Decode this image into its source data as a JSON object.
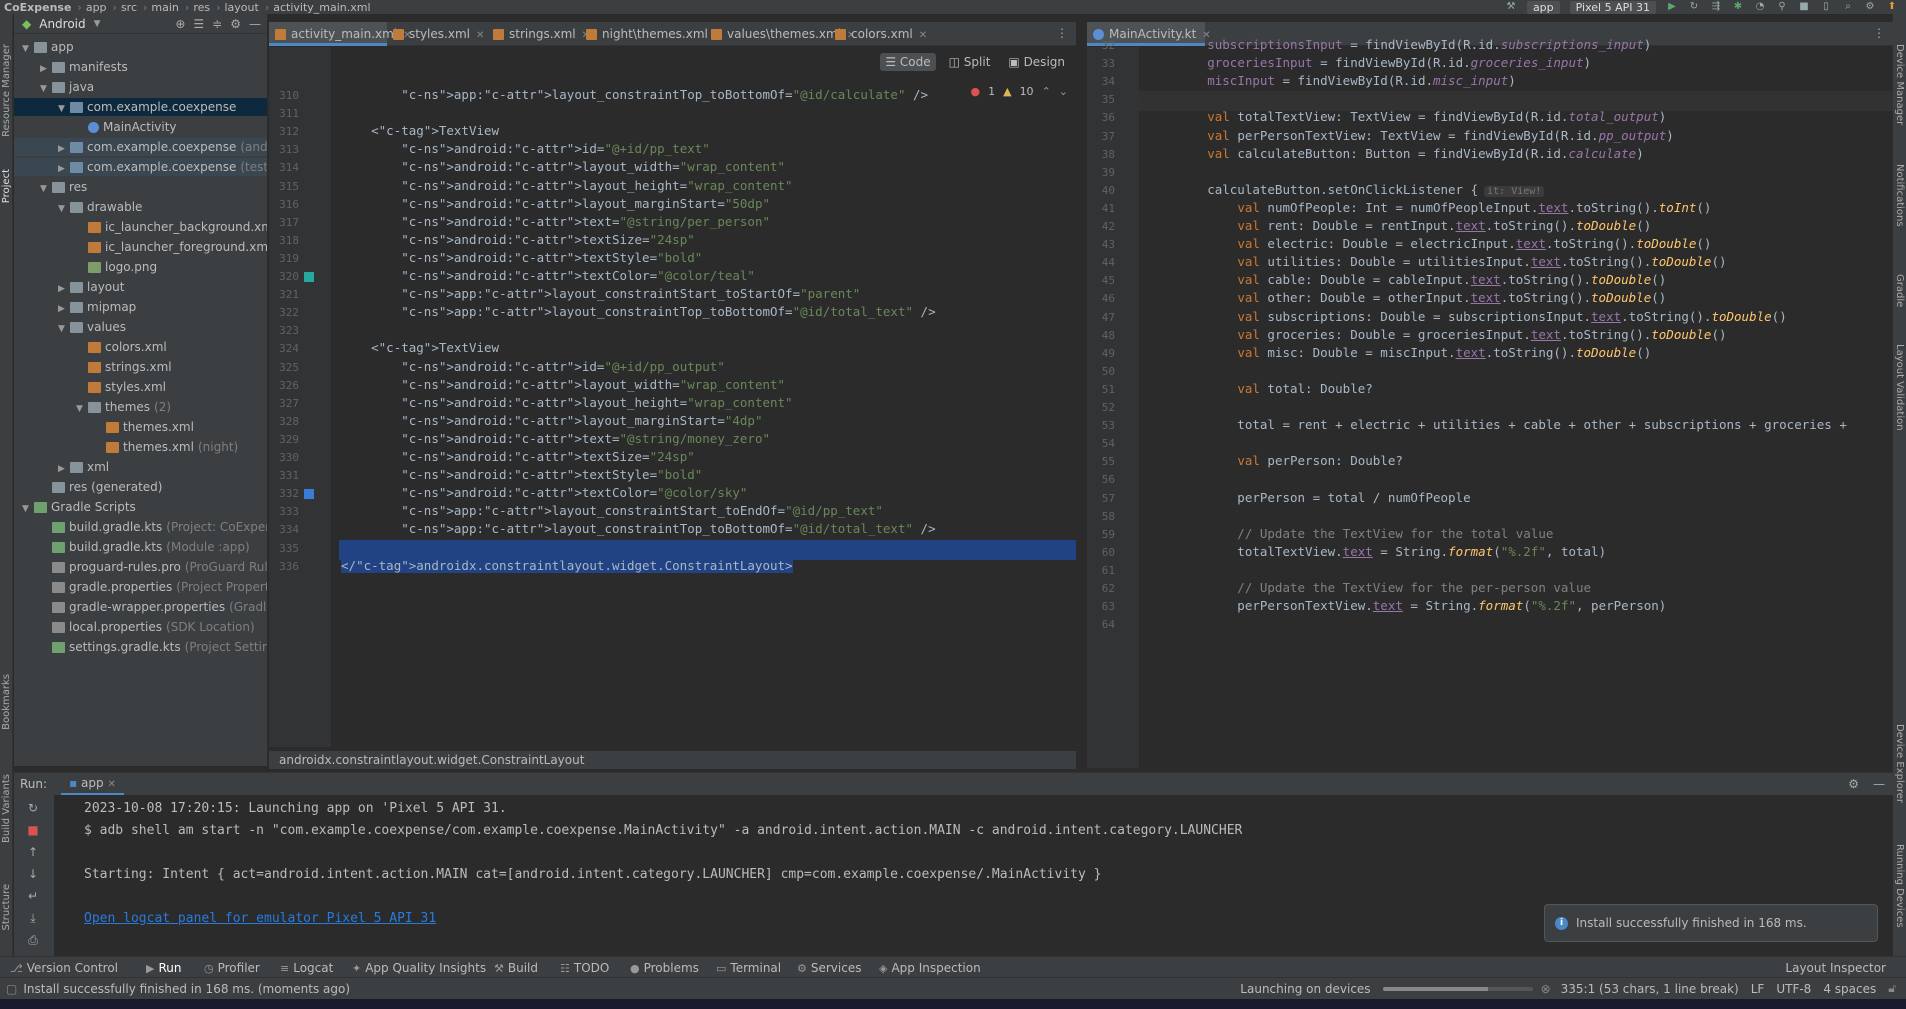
{
  "breadcrumb": [
    "CoExpense",
    "app",
    "src",
    "main",
    "res",
    "layout",
    "activity_main.xml"
  ],
  "toolbar": {
    "run_config": "app",
    "device": "Pixel 5 API 31"
  },
  "project_panel": {
    "view": "Android",
    "items": [
      {
        "label": "app",
        "sub": "",
        "icon": "folder"
      },
      {
        "label": "manifests",
        "sub": "",
        "icon": "folder"
      },
      {
        "label": "java",
        "sub": "",
        "icon": "folder"
      },
      {
        "label": "com.example.coexpense",
        "sub": "",
        "icon": "package"
      },
      {
        "label": "MainActivity",
        "sub": "",
        "icon": "kotlin-file"
      },
      {
        "label": "com.example.coexpense",
        "sub": "(androidTest)",
        "icon": "package"
      },
      {
        "label": "com.example.coexpense",
        "sub": "(test)",
        "icon": "package"
      },
      {
        "label": "res",
        "sub": "",
        "icon": "folder"
      },
      {
        "label": "drawable",
        "sub": "",
        "icon": "folder"
      },
      {
        "label": "ic_launcher_background.xml",
        "sub": "",
        "icon": "xml-file"
      },
      {
        "label": "ic_launcher_foreground.xml",
        "sub": "",
        "icon": "xml-file"
      },
      {
        "label": "logo.png",
        "sub": "",
        "icon": "image-file"
      },
      {
        "label": "layout",
        "sub": "",
        "icon": "folder"
      },
      {
        "label": "mipmap",
        "sub": "",
        "icon": "folder"
      },
      {
        "label": "values",
        "sub": "",
        "icon": "folder"
      },
      {
        "label": "colors.xml",
        "sub": "",
        "icon": "xml-file"
      },
      {
        "label": "strings.xml",
        "sub": "",
        "icon": "xml-file"
      },
      {
        "label": "styles.xml",
        "sub": "",
        "icon": "xml-file"
      },
      {
        "label": "themes",
        "sub": "(2)",
        "icon": "folder"
      },
      {
        "label": "themes.xml",
        "sub": "",
        "icon": "xml-file"
      },
      {
        "label": "themes.xml",
        "sub": "(night)",
        "icon": "xml-file"
      },
      {
        "label": "xml",
        "sub": "",
        "icon": "folder"
      },
      {
        "label": "res (generated)",
        "sub": "",
        "icon": "folder"
      },
      {
        "label": "Gradle Scripts",
        "sub": "",
        "icon": "gradle"
      },
      {
        "label": "build.gradle.kts",
        "sub": "(Project: CoExpense)",
        "icon": "gradle-file"
      },
      {
        "label": "build.gradle.kts",
        "sub": "(Module :app)",
        "icon": "gradle-file"
      },
      {
        "label": "proguard-rules.pro",
        "sub": "(ProGuard Rules for \":app\")",
        "icon": "properties-file"
      },
      {
        "label": "gradle.properties",
        "sub": "(Project Properties)",
        "icon": "properties-file"
      },
      {
        "label": "gradle-wrapper.properties",
        "sub": "(Gradle Version)",
        "icon": "properties-file"
      },
      {
        "label": "local.properties",
        "sub": "(SDK Location)",
        "icon": "properties-file"
      },
      {
        "label": "settings.gradle.kts",
        "sub": "(Project Settings)",
        "icon": "gradle-file"
      }
    ]
  },
  "editor_tabs_left": [
    "activity_main.xml",
    "styles.xml",
    "strings.xml",
    "night\\themes.xml",
    "values\\themes.xml",
    "colors.xml"
  ],
  "editor_tabs_right": [
    "MainActivity.kt"
  ],
  "view_modes": [
    "Code",
    "Split",
    "Design"
  ],
  "inspections": {
    "errors": "1",
    "warnings": "10"
  },
  "xml_editor": {
    "lines": [
      {
        "n": "310",
        "text": "        app:layout_constraintTop_toBottomOf=\"@id/calculate\" />"
      },
      {
        "n": "311",
        "text": ""
      },
      {
        "n": "312",
        "text": "    <TextView"
      },
      {
        "n": "313",
        "text": "        android:id=\"@+id/pp_text\""
      },
      {
        "n": "314",
        "text": "        android:layout_width=\"wrap_content\""
      },
      {
        "n": "315",
        "text": "        android:layout_height=\"wrap_content\""
      },
      {
        "n": "316",
        "text": "        android:layout_marginStart=\"50dp\""
      },
      {
        "n": "317",
        "text": "        android:text=\"@string/per_person\""
      },
      {
        "n": "318",
        "text": "        android:textSize=\"24sp\""
      },
      {
        "n": "319",
        "text": "        android:textStyle=\"bold\""
      },
      {
        "n": "320",
        "text": "        android:textColor=\"@color/teal\""
      },
      {
        "n": "321",
        "text": "        app:layout_constraintStart_toStartOf=\"parent\""
      },
      {
        "n": "322",
        "text": "        app:layout_constraintTop_toBottomOf=\"@id/total_text\" />"
      },
      {
        "n": "323",
        "text": ""
      },
      {
        "n": "324",
        "text": "    <TextView"
      },
      {
        "n": "325",
        "text": "        android:id=\"@+id/pp_output\""
      },
      {
        "n": "326",
        "text": "        android:layout_width=\"wrap_content\""
      },
      {
        "n": "327",
        "text": "        android:layout_height=\"wrap_content\""
      },
      {
        "n": "328",
        "text": "        android:layout_marginStart=\"4dp\""
      },
      {
        "n": "329",
        "text": "        android:text=\"@string/money_zero\""
      },
      {
        "n": "330",
        "text": "        android:textSize=\"24sp\""
      },
      {
        "n": "331",
        "text": "        android:textStyle=\"bold\""
      },
      {
        "n": "332",
        "text": "        android:textColor=\"@color/sky\""
      },
      {
        "n": "333",
        "text": "        app:layout_constraintStart_toEndOf=\"@id/pp_text\""
      },
      {
        "n": "334",
        "text": "        app:layout_constraintTop_toBottomOf=\"@id/total_text\" />"
      },
      {
        "n": "335",
        "text": ""
      },
      {
        "n": "336",
        "text": "</androidx.constraintlayout.widget.ConstraintLayout>"
      }
    ],
    "footer_path": "androidx.constraintlayout.widget.ConstraintLayout"
  },
  "kt_editor": {
    "lines": [
      {
        "n": "32",
        "text": "        subscriptionsInput = findViewById(R.id.subscriptions_input)"
      },
      {
        "n": "33",
        "text": "        groceriesInput = findViewById(R.id.groceries_input)"
      },
      {
        "n": "34",
        "text": "        miscInput = findViewById(R.id.misc_input)"
      },
      {
        "n": "35",
        "text": ""
      },
      {
        "n": "36",
        "text": "        val totalTextView: TextView = findViewById(R.id.total_output)"
      },
      {
        "n": "37",
        "text": "        val perPersonTextView: TextView = findViewById(R.id.pp_output)"
      },
      {
        "n": "38",
        "text": "        val calculateButton: Button = findViewById(R.id.calculate)"
      },
      {
        "n": "39",
        "text": ""
      },
      {
        "n": "40",
        "text": "        calculateButton.setOnClickListener {"
      },
      {
        "n": "41",
        "text": "            val numOfPeople: Int = numOfPeopleInput.text.toString().toInt()"
      },
      {
        "n": "42",
        "text": "            val rent: Double = rentInput.text.toString().toDouble()"
      },
      {
        "n": "43",
        "text": "            val electric: Double = electricInput.text.toString().toDouble()"
      },
      {
        "n": "44",
        "text": "            val utilities: Double = utilitiesInput.text.toString().toDouble()"
      },
      {
        "n": "45",
        "text": "            val cable: Double = cableInput.text.toString().toDouble()"
      },
      {
        "n": "46",
        "text": "            val other: Double = otherInput.text.toString().toDouble()"
      },
      {
        "n": "47",
        "text": "            val subscriptions: Double = subscriptionsInput.text.toString().toDouble()"
      },
      {
        "n": "48",
        "text": "            val groceries: Double = groceriesInput.text.toString().toDouble()"
      },
      {
        "n": "49",
        "text": "            val misc: Double = miscInput.text.toString().toDouble()"
      },
      {
        "n": "50",
        "text": ""
      },
      {
        "n": "51",
        "text": "            val total: Double?"
      },
      {
        "n": "52",
        "text": ""
      },
      {
        "n": "53",
        "text": "            total = rent + electric + utilities + cable + other + subscriptions + groceries +"
      },
      {
        "n": "54",
        "text": ""
      },
      {
        "n": "55",
        "text": "            val perPerson: Double?"
      },
      {
        "n": "56",
        "text": ""
      },
      {
        "n": "57",
        "text": "            perPerson = total / numOfPeople"
      },
      {
        "n": "58",
        "text": ""
      },
      {
        "n": "59",
        "text": "            // Update the TextView for the total value"
      },
      {
        "n": "60",
        "text": "            totalTextView.text = String.format(\"%.2f\", total)"
      },
      {
        "n": "61",
        "text": ""
      },
      {
        "n": "62",
        "text": "            // Update the TextView for the per-person value"
      },
      {
        "n": "63",
        "text": "            perPersonTextView.text = String.format(\"%.2f\", perPerson)"
      },
      {
        "n": "64",
        "text": ""
      }
    ],
    "inlay_hint": "it: View!"
  },
  "run_panel": {
    "title": "Run:",
    "tab": "app",
    "console": [
      "2023-10-08 17:20:15: Launching app on 'Pixel 5 API 31.",
      "$ adb shell am start -n \"com.example.coexpense/com.example.coexpense.MainActivity\" -a android.intent.action.MAIN -c android.intent.category.LAUNCHER",
      "",
      "Starting: Intent { act=android.intent.action.MAIN cat=[android.intent.category.LAUNCHER] cmp=com.example.coexpense/.MainActivity }",
      ""
    ],
    "logcat_link": "Open logcat panel for emulator Pixel 5 API 31"
  },
  "toast": "Install successfully finished in 168 ms.",
  "bottom_tabs": [
    "Version Control",
    "Run",
    "Profiler",
    "Logcat",
    "App Quality Insights",
    "Build",
    "TODO",
    "Problems",
    "Terminal",
    "Services",
    "App Inspection"
  ],
  "bottom_right_tab": "Layout Inspector",
  "left_strip_labels": [
    "Resource Manager",
    "Project",
    "Bookmarks",
    "Build Variants",
    "Structure"
  ],
  "right_strip_labels": [
    "Device Manager",
    "Notifications",
    "Gradle",
    "Layout Validation",
    "Device Explorer",
    "Running Devices"
  ],
  "status": {
    "message": "Install successfully finished in 168 ms. (moments ago)",
    "task": "Launching on devices",
    "position": "335:1 (53 chars, 1 line break)",
    "line_sep": "LF",
    "encoding": "UTF-8",
    "indent": "4 spaces"
  },
  "colors": {
    "accent": "#4a88c7",
    "selection": "#214283",
    "background": "#2b2b2b",
    "panel": "#3c3f41"
  }
}
